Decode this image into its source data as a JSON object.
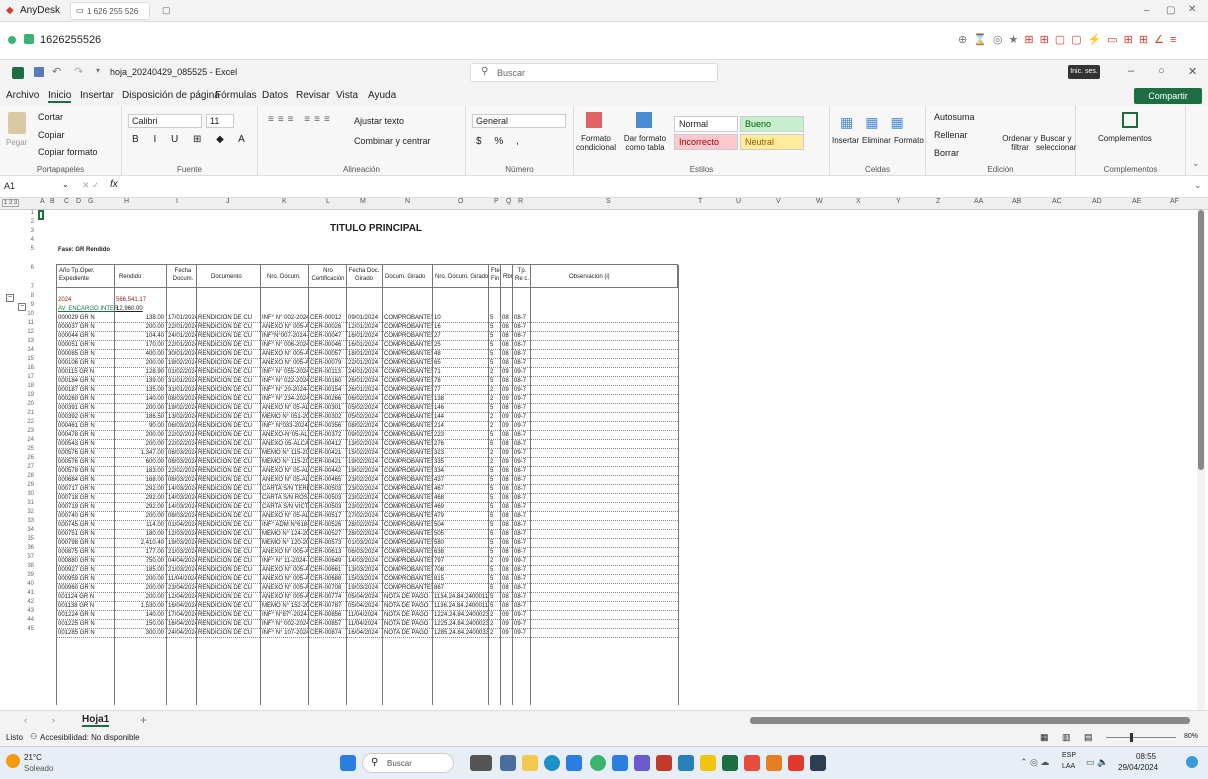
{
  "anydesk": {
    "app": "AnyDesk",
    "session": "1 626 255 526",
    "address": "1626255526"
  },
  "excel": {
    "filename": "hoja_20240429_085525 - Excel",
    "search": "Buscar",
    "signin": "Inic. ses."
  },
  "menu": [
    "Archivo",
    "Inicio",
    "Insertar",
    "Disposición de página",
    "Fórmulas",
    "Datos",
    "Revisar",
    "Vista",
    "Ayuda"
  ],
  "share": "Compartir",
  "ribbon": {
    "clipboard": {
      "cut": "Cortar",
      "copy": "Copiar",
      "paste": "Pegar",
      "format": "Copiar formato",
      "label": "Portapapeles"
    },
    "font": {
      "name": "Calibri",
      "size": "11",
      "label": "Fuente"
    },
    "align": {
      "wrap": "Ajustar texto",
      "merge": "Combinar y centrar",
      "label": "Alineación"
    },
    "number": {
      "format": "General",
      "label": "Número"
    },
    "styles": {
      "cond": "Formato condicional",
      "table": "Dar formato como tabla",
      "normal": "Normal",
      "good": "Bueno",
      "bad": "Incorrecto",
      "neutral": "Neutral",
      "label": "Estilos"
    },
    "cells": {
      "insert": "Insertar",
      "delete": "Eliminar",
      "format": "Formato",
      "label": "Celdas"
    },
    "edit": {
      "autosum": "Autosuma",
      "fill": "Rellenar",
      "clear": "Borrar",
      "sort": "Ordenar y filtrar",
      "find": "Buscar y seleccionar",
      "label": "Edición"
    },
    "addins": {
      "btn": "Complementos",
      "label": "Complementos"
    }
  },
  "formula": {
    "cell": "A1",
    "fx": "fx",
    "value": ""
  },
  "columns": [
    "A",
    "B",
    "C",
    "D",
    "G",
    "H",
    "I",
    "J",
    "K",
    "L",
    "M",
    "N",
    "O",
    "P",
    "Q",
    "R",
    "S",
    "T",
    "U",
    "V",
    "W",
    "X",
    "Y",
    "Z",
    "AA",
    "AB",
    "AC",
    "AD",
    "AE",
    "AF"
  ],
  "sheet": {
    "title": "TITULO PRINCIPAL",
    "subtitle": "Fase: GR Rendido",
    "headers": [
      "Año Tp.Oper. Expediente",
      "Rendido",
      "Fecha Docum.",
      "Documento",
      "Nro. Docum.",
      "Nro Certificación",
      "Fecha Doc. Girado",
      "Docum. Girado",
      "Nro. Docum. Girado",
      "Fte. Fin.",
      "Rbr",
      "Tp. Re c.",
      "Observación (i)"
    ],
    "row8": {
      "year": "2024",
      "amount": "566,541.17"
    },
    "row9": {
      "label": "AV. ENCARGO INTER",
      "amount": "12,960.00"
    },
    "rows": [
      [
        "000029 GR N",
        "138.00",
        "17/01/2024",
        "RENDICION DE CU",
        "INF° N° 002-2024-M",
        "CER-00012",
        "09/01/2024",
        "COMPROBANTES",
        "10",
        "5",
        "08",
        "08-7"
      ],
      [
        "000037 GR N",
        "200.00",
        "22/01/2024",
        "RENDICION DE CU",
        "ANEXO N° 005-ALC",
        "CER-00026",
        "12/01/2024",
        "COMPROBANTES",
        "16",
        "5",
        "08",
        "08-7"
      ],
      [
        "000044 GR N",
        "104.40",
        "24/01/2024",
        "RENDICION DE CU",
        "INF°N°007-2024-MP",
        "CER-00047",
        "16/01/2024",
        "COMPROBANTES",
        "27",
        "5",
        "08",
        "08-7"
      ],
      [
        "000051 GR N",
        "170.00",
        "22/01/2024",
        "RENDICION DE CU",
        "INF° N° 006-2024-M",
        "CER-00046",
        "16/01/2024",
        "COMPROBANTES",
        "25",
        "5",
        "08",
        "08-7"
      ],
      [
        "000085 GR N",
        "400.00",
        "30/01/2024",
        "RENDICION DE CU",
        "ANEXO N° 005-ALC",
        "CER-00057",
        "18/01/2024",
        "COMPROBANTES",
        "48",
        "5",
        "08",
        "08-7"
      ],
      [
        "000106 GR N",
        "200.00",
        "19/02/2024",
        "RENDICION DE CU",
        "ANEXO N° 005-ALC",
        "CER-00079",
        "22/01/2024",
        "COMPROBANTES",
        "65",
        "5",
        "08",
        "08-7"
      ],
      [
        "000115 GR N",
        "128.90",
        "01/02/2024",
        "RENDICION DE CU",
        "INF° N° 055-2024-M",
        "CER-00113",
        "24/01/2024",
        "COMPROBANTES",
        "71",
        "2",
        "09",
        "09-7"
      ],
      [
        "000184 GR N",
        "139.00",
        "31/01/2024",
        "RENDICION DE CU",
        "INF° N° 022-2024-M",
        "CER-00160",
        "26/01/2024",
        "COMPROBANTES",
        "78",
        "5",
        "08",
        "08-7"
      ],
      [
        "000187 GR N",
        "135.00",
        "31/01/2024",
        "RENDICION DE CU",
        "INF° N° 20-2024-M",
        "CER-00154",
        "26/01/2024",
        "COMPROBANTES",
        "77",
        "2",
        "09",
        "09-7"
      ],
      [
        "000260 GR N",
        "140.00",
        "08/03/2024",
        "RENDICION DE CU",
        "INF° N° 234-2024-M",
        "CER-00266",
        "06/02/2024",
        "COMPROBANTES",
        "138",
        "2",
        "09",
        "09-7"
      ],
      [
        "000391 GR N",
        "200.00",
        "19/02/2024",
        "RENDICION DE CU",
        "ANEXO N° 05-ALCA",
        "CER-00301",
        "05/02/2024",
        "COMPROBANTES",
        "146",
        "5",
        "08",
        "08-7"
      ],
      [
        "000392 GR N",
        "186.50",
        "13/02/2024",
        "RENDICION DE CU",
        "MEMO N° 051-2024",
        "CER-00302",
        "05/02/2024",
        "COMPROBANTES",
        "144",
        "2",
        "09",
        "09-7"
      ],
      [
        "000461 GR N",
        "90.00",
        "06/03/2024",
        "RENDICION DE CU",
        "INF° N°033-2024-M",
        "CER-00356",
        "08/02/2024",
        "COMPROBANTES",
        "214",
        "2",
        "09",
        "09-7"
      ],
      [
        "000478 GR N",
        "200.00",
        "22/02/2024",
        "RENDICION DE CU",
        "ANEXO-N°05-ALCA",
        "CER-00372",
        "09/02/2024",
        "COMPROBANTES",
        "223",
        "5",
        "08",
        "08-7"
      ],
      [
        "000543 GR N",
        "200.00",
        "22/02/2024",
        "RENDICION DE CU",
        "ANEXO 05-ALCALD",
        "CER-00412",
        "13/02/2024",
        "COMPROBANTES",
        "276",
        "5",
        "08",
        "08-7"
      ],
      [
        "000576 GR N",
        "1,347.00",
        "08/03/2024",
        "RENDICION DE CU",
        "MEMO N° 115-2024",
        "CER-00421",
        "15/02/2024",
        "COMPROBANTES",
        "323",
        "2",
        "09",
        "09-7"
      ],
      [
        "000576 GR N",
        "600.00",
        "08/03/2024",
        "RENDICION DE CU",
        "MEMO N° 115-2024",
        "CER-00421",
        "19/02/2024",
        "COMPROBANTES",
        "335",
        "2",
        "09",
        "09-7"
      ],
      [
        "000578 GR N",
        "183.00",
        "22/02/2024",
        "RENDICION DE CU",
        "ANEXO N° 05-ALCA",
        "CER-00442",
        "19/02/2024",
        "COMPROBANTES",
        "334",
        "5",
        "08",
        "08-7"
      ],
      [
        "000684 GR N",
        "168.00",
        "08/03/2024",
        "RENDICION DE CU",
        "ANEXO N° 05-ALCA",
        "CER-00465",
        "23/02/2024",
        "COMPROBANTES",
        "437",
        "5",
        "08",
        "08-7"
      ],
      [
        "000717 GR N",
        "292.00",
        "14/03/2024",
        "RENDICION DE CU",
        "CARTA S/N TERES",
        "CER-00503",
        "23/02/2024",
        "COMPROBANTES",
        "467",
        "5",
        "08",
        "08-7"
      ],
      [
        "000718 GR N",
        "292.00",
        "14/03/2024",
        "RENDICION DE CU",
        "CARTA S/N ROSAR",
        "CER-00503",
        "23/02/2024",
        "COMPROBANTES",
        "468",
        "5",
        "08",
        "08-7"
      ],
      [
        "000719 GR N",
        "292.00",
        "14/03/2024",
        "RENDICION DE CU",
        "CARTA S/N VICTO",
        "CER-00503",
        "23/02/2024",
        "COMPROBANTES",
        "469",
        "5",
        "08",
        "08-7"
      ],
      [
        "000740 GR N",
        "200.00",
        "08/03/2024",
        "RENDICION DE CU",
        "ANEXO N° 05-ALCA",
        "CER-00517",
        "27/02/2024",
        "COMPROBANTES",
        "479",
        "5",
        "08",
        "08-7"
      ],
      [
        "000745 GR N",
        "114.00",
        "01/04/2024",
        "RENDICION DE CU",
        "INF° ADM N°618-20",
        "CER-00526",
        "28/02/2024",
        "COMPROBANTES",
        "504",
        "5",
        "08",
        "08-7"
      ],
      [
        "000751 GR N",
        "180.00",
        "12/03/2024",
        "RENDICION DE CU",
        "MEMO N° 124-2024",
        "CER-00527",
        "28/02/2024",
        "COMPROBANTES",
        "505",
        "5",
        "08",
        "08-7"
      ],
      [
        "000798 GR N",
        "2,410.40",
        "19/03/2024",
        "RENDICION DE CU",
        "MEMO N° 120-2024",
        "CER-00573",
        "01/03/2024",
        "COMPROBANTES",
        "580",
        "5",
        "08",
        "08-7"
      ],
      [
        "000875 GR N",
        "177.00",
        "21/03/2024",
        "RENDICION DE CU",
        "ANEXO N° 005-ALC",
        "CER-00613",
        "06/03/2024",
        "COMPROBANTES",
        "638",
        "5",
        "08",
        "08-7"
      ],
      [
        "000880 GR N",
        "750.00",
        "04/04/2024",
        "RENDICION DE CU",
        "INF° N° 11-2024-M",
        "CER-00649",
        "14/03/2024",
        "COMPROBANTES",
        "797",
        "2",
        "09",
        "09-7"
      ],
      [
        "000927 GR N",
        "185.00",
        "21/03/2024",
        "RENDICION DE CU",
        "ANEXO N° 005-ALC",
        "CER-00661",
        "13/03/2024",
        "COMPROBANTES",
        "708",
        "5",
        "08",
        "08-7"
      ],
      [
        "000959 GR N",
        "200.00",
        "11/04/2024",
        "RENDICION DE CU",
        "ANEXO N° 005-ALC",
        "CER-00688",
        "15/03/2024",
        "COMPROBANTES",
        "815",
        "5",
        "08",
        "08-7"
      ],
      [
        "000960 GR N",
        "200.00",
        "23/04/2024",
        "RENDICION DE CU",
        "ANEXO N° 005-ALC",
        "CER-00708",
        "19/03/2024",
        "COMPROBANTES",
        "867",
        "5",
        "08",
        "08-7"
      ],
      [
        "001124 GR N",
        "200.00",
        "12/04/2024",
        "RENDICION DE CU",
        "ANEXO N° 005-ALC",
        "CER-00774",
        "05/04/2024",
        "NOTA DE PAGO",
        "1134.24.84.2400011",
        "5",
        "08",
        "08-7"
      ],
      [
        "001138 GR N",
        "1,530.00",
        "16/04/2024",
        "RENDICION DE CU",
        "MEMO N° 152-2024",
        "CER-00787",
        "05/04/2024",
        "NOTA DE PAGO",
        "1136.24.84.2400011",
        "5",
        "08",
        "08-7"
      ],
      [
        "001224 GR N",
        "140.00",
        "17/04/2024",
        "RENDICION DE CU",
        "INF° N°87°-2024-M",
        "CER-00856",
        "11/04/2024",
        "NOTA DE PAGO",
        "1224.24.84.2400023",
        "2",
        "09",
        "09-7"
      ],
      [
        "001225 GR N",
        "150.00",
        "16/04/2024",
        "RENDICION DE CU",
        "INF° N° 002-2024-M",
        "CER-00857",
        "11/04/2024",
        "NOTA DE PAGO",
        "1225.24.84.2400023",
        "2",
        "09",
        "09-7"
      ],
      [
        "001285 GR N",
        "300.00",
        "24/04/2024",
        "RENDICION DE CU",
        "INF° N° 107-2024-M",
        "CER-00874",
        "16/04/2024",
        "NOTA DE PAGO",
        "1285.24.84.2400033",
        "2",
        "09",
        "09-7"
      ]
    ],
    "rownums": [
      "1",
      "2",
      "3",
      "4",
      "5",
      "6",
      "7",
      "8",
      "9",
      "10",
      "11",
      "12",
      "13",
      "14",
      "15",
      "16",
      "17",
      "18",
      "19",
      "20",
      "21",
      "22",
      "23",
      "24",
      "25",
      "26",
      "27",
      "28",
      "29",
      "30",
      "31",
      "32",
      "33",
      "34",
      "35",
      "36",
      "37",
      "38",
      "39",
      "40",
      "41",
      "42",
      "43",
      "44",
      "45"
    ]
  },
  "sheettab": "Hoja1",
  "status": {
    "ready": "Listo",
    "access": "Accesibilidad: No disponible",
    "zoom": "80%"
  },
  "taskbar": {
    "temp": "21°C",
    "weather": "Soleado",
    "search": "Buscar",
    "lang": "ESP",
    "lang2": "LAA",
    "time": "08:55",
    "date": "29/04/2024"
  }
}
